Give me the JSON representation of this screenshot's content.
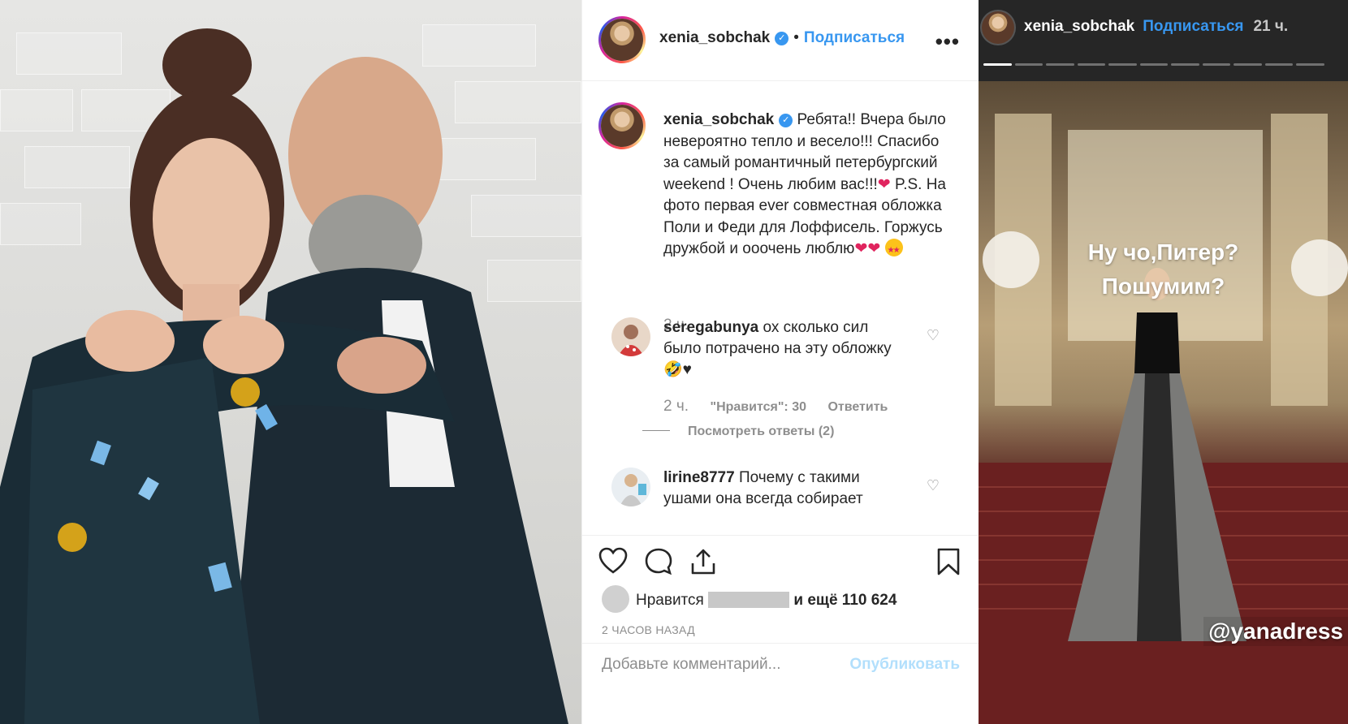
{
  "post": {
    "header": {
      "username": "xenia_sobchak",
      "dot": "•",
      "follow_label": "Подписаться",
      "more_label": "•••"
    },
    "caption": {
      "username": "xenia_sobchak",
      "text_1": "Ребята!! Вчера было невероятно тепло и весело!!! Спасибо за самый романтичный петербургский weekend ! Очень любим вас!!!",
      "heart": "❤",
      "text_2": " P.S. На фото первая ever совместная обложка Поли и Феди для Лоффисель. Горжусь дружбой и ооочень люблю",
      "hearts_end": "❤❤",
      "time": "2 ч."
    },
    "comments": [
      {
        "username": "seregabunya",
        "text": "ох сколько сил было потрачено на эту обложку",
        "emoji_line": "🤣♥",
        "time": "2 ч.",
        "likes": "\"Нравится\": 30",
        "reply_label": "Ответить",
        "view_replies": "Посмотреть ответы (2)"
      },
      {
        "username": "lirine8777",
        "text": "Почему с такими ушами она всегда собирает"
      }
    ],
    "likes": {
      "prefix": "Нравится",
      "suffix": "и ещё 110 624"
    },
    "timestamp": "2 ЧАСОВ НАЗАД",
    "comment_input_placeholder": "Добавьте комментарий...",
    "publish_label": "Опубликовать"
  },
  "story": {
    "username": "xenia_sobchak",
    "follow_label": "Подписаться",
    "time": "21 ч.",
    "caption_line_1": "Ну чо,Питер?",
    "caption_line_2": "Пошумим?",
    "mention": "@yanadress"
  },
  "colors": {
    "link_blue": "#3897f0",
    "heart_red": "#e0245e",
    "secondary_text": "#8e8e8e"
  },
  "icons": [
    "heart-icon",
    "comment-icon",
    "share-icon",
    "bookmark-icon",
    "more-icon",
    "verified-icon"
  ]
}
